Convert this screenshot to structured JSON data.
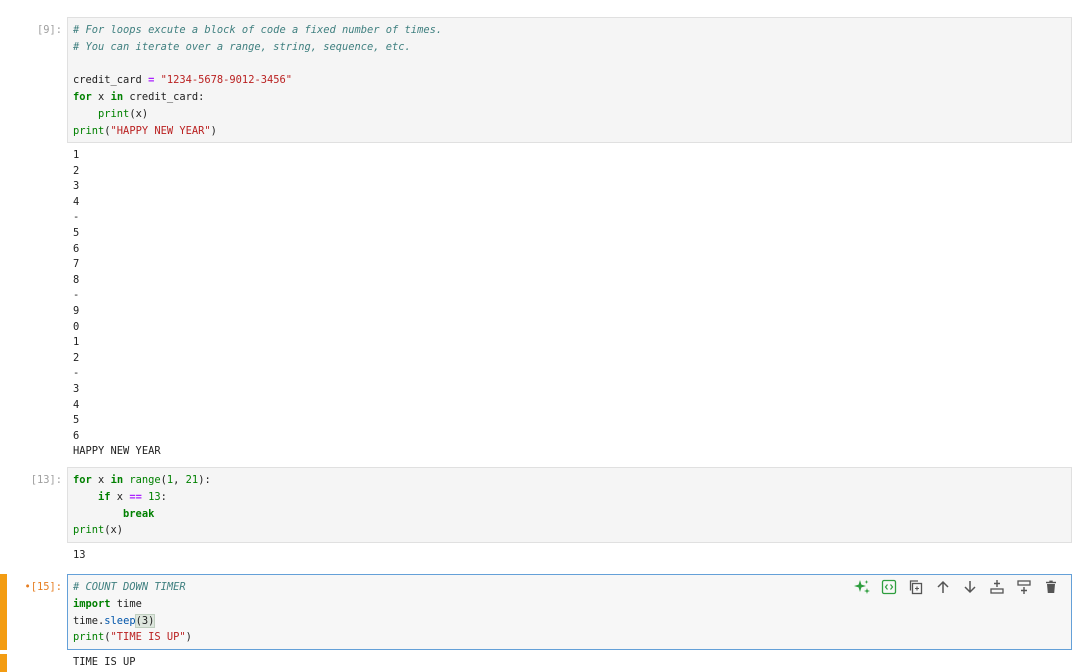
{
  "cells": [
    {
      "prompt": "[9]:",
      "code": [
        [
          {
            "t": "# For loops excute a block of code a fixed number of times.",
            "c": "cm"
          }
        ],
        [
          {
            "t": "# You can iterate over a range, string, sequence, etc.",
            "c": "cm"
          }
        ],
        [],
        [
          {
            "t": "credit_card ",
            "c": ""
          },
          {
            "t": "=",
            "c": "op"
          },
          {
            "t": " ",
            "c": ""
          },
          {
            "t": "\"1234-5678-9012-3456\"",
            "c": "st"
          }
        ],
        [
          {
            "t": "for",
            "c": "kw"
          },
          {
            "t": " x ",
            "c": ""
          },
          {
            "t": "in",
            "c": "kw"
          },
          {
            "t": " credit_card:",
            "c": ""
          }
        ],
        [
          {
            "t": "    ",
            "c": ""
          },
          {
            "t": "print",
            "c": "bi"
          },
          {
            "t": "(x)",
            "c": ""
          }
        ],
        [
          {
            "t": "print",
            "c": "bi"
          },
          {
            "t": "(",
            "c": ""
          },
          {
            "t": "\"HAPPY NEW YEAR\"",
            "c": "st"
          },
          {
            "t": ")",
            "c": ""
          }
        ]
      ],
      "output": [
        "1",
        "2",
        "3",
        "4",
        "-",
        "5",
        "6",
        "7",
        "8",
        "-",
        "9",
        "0",
        "1",
        "2",
        "-",
        "3",
        "4",
        "5",
        "6",
        "HAPPY NEW YEAR"
      ]
    },
    {
      "prompt": "[13]:",
      "code": [
        [
          {
            "t": "for",
            "c": "kw"
          },
          {
            "t": " x ",
            "c": ""
          },
          {
            "t": "in",
            "c": "kw"
          },
          {
            "t": " ",
            "c": ""
          },
          {
            "t": "range",
            "c": "bi"
          },
          {
            "t": "(",
            "c": ""
          },
          {
            "t": "1",
            "c": "nu"
          },
          {
            "t": ", ",
            "c": ""
          },
          {
            "t": "21",
            "c": "nu"
          },
          {
            "t": "):",
            "c": ""
          }
        ],
        [
          {
            "t": "    ",
            "c": ""
          },
          {
            "t": "if",
            "c": "kw"
          },
          {
            "t": " x ",
            "c": ""
          },
          {
            "t": "==",
            "c": "op"
          },
          {
            "t": " ",
            "c": ""
          },
          {
            "t": "13",
            "c": "nu"
          },
          {
            "t": ":",
            "c": ""
          }
        ],
        [
          {
            "t": "        ",
            "c": ""
          },
          {
            "t": "break",
            "c": "kw"
          }
        ],
        [
          {
            "t": "print",
            "c": "bi"
          },
          {
            "t": "(x)",
            "c": ""
          }
        ]
      ],
      "output": [
        "13"
      ]
    },
    {
      "prompt": "[15]:",
      "active_marker": "•",
      "code": [
        [
          {
            "t": "# COUNT DOWN TIMER",
            "c": "cm"
          }
        ],
        [
          {
            "t": "import",
            "c": "kw"
          },
          {
            "t": " time",
            "c": ""
          }
        ],
        [
          {
            "t": "time",
            "c": ""
          },
          {
            "t": ".",
            "c": ""
          },
          {
            "t": "sleep",
            "c": "fn"
          },
          {
            "t": "(3)",
            "c": "hl"
          }
        ],
        [
          {
            "t": "print",
            "c": "bi"
          },
          {
            "t": "(",
            "c": ""
          },
          {
            "t": "\"TIME IS UP\"",
            "c": "st"
          },
          {
            "t": ")",
            "c": ""
          }
        ]
      ],
      "output": [
        "TIME IS UP"
      ],
      "toolbar": [
        {
          "name": "ai-assist-icon",
          "glyph": "sparkle"
        },
        {
          "name": "code-view-icon",
          "glyph": "code"
        },
        {
          "name": "duplicate-icon",
          "glyph": "copy"
        },
        {
          "name": "move-up-icon",
          "glyph": "up"
        },
        {
          "name": "move-down-icon",
          "glyph": "down"
        },
        {
          "name": "insert-above-icon",
          "glyph": "insert-above"
        },
        {
          "name": "insert-below-icon",
          "glyph": "insert-below"
        },
        {
          "name": "delete-icon",
          "glyph": "trash"
        }
      ]
    }
  ],
  "colors": {
    "comment": "#408080",
    "keyword": "#008000",
    "string": "#ba2121",
    "active_prompt": "#e67e22",
    "selection_border": "#64a0d8",
    "collapser": "#f39c12",
    "ai_icon": "#2e9e3e"
  }
}
